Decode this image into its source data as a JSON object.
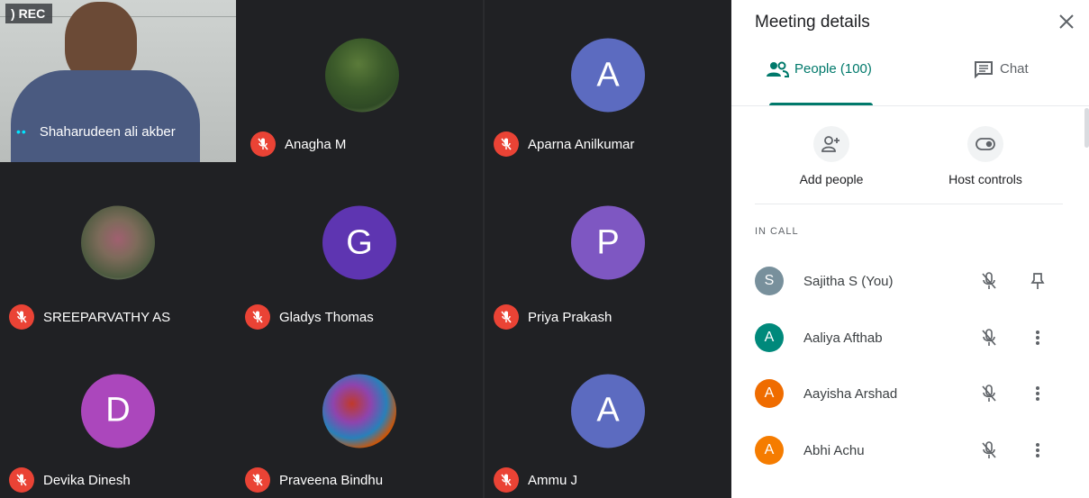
{
  "recording": {
    "label": "REC"
  },
  "tiles": [
    {
      "name": "Shaharudeen ali akber",
      "type": "video"
    },
    {
      "name": "Anagha M",
      "type": "photo",
      "photo": "photo-a",
      "muted": true
    },
    {
      "name": "Aparna Anilkumar",
      "type": "letter",
      "letter": "A",
      "color": "#5c6bc0",
      "muted": true
    },
    {
      "name": "SREEPARVATHY AS",
      "type": "photo",
      "photo": "photo-b",
      "muted": true
    },
    {
      "name": "Gladys Thomas",
      "type": "letter",
      "letter": "G",
      "color": "#5e35b1",
      "muted": true
    },
    {
      "name": "Priya Prakash",
      "type": "letter",
      "letter": "P",
      "color": "#7e57c2",
      "muted": true
    },
    {
      "name": "Devika Dinesh",
      "type": "letter",
      "letter": "D",
      "color": "#ab47bc",
      "muted": true
    },
    {
      "name": "Praveena Bindhu",
      "type": "photo",
      "photo": "photo-c",
      "muted": true
    },
    {
      "name": "Ammu J",
      "type": "letter",
      "letter": "A",
      "color": "#5c6bc0",
      "muted": true
    }
  ],
  "panel": {
    "title": "Meeting details",
    "tabs": {
      "people": "People (100)",
      "chat": "Chat"
    },
    "actions": {
      "add_people": "Add people",
      "host_controls": "Host controls"
    },
    "section_label": "IN CALL",
    "people": [
      {
        "name": "Sajitha S (You)",
        "initial": "S",
        "color": "#78909c",
        "trailing": "pin-icon"
      },
      {
        "name": "Aaliya Afthab",
        "initial": "A",
        "color": "#00897b",
        "trailing": "more-icon"
      },
      {
        "name": "Aayisha Arshad",
        "initial": "A",
        "color": "#ef6c00",
        "trailing": "more-icon"
      },
      {
        "name": "Abhi Achu",
        "initial": "A",
        "color": "#f57c00",
        "trailing": "more-icon"
      }
    ]
  },
  "colors": {
    "accent": "#00796b",
    "tile_bg": "#202124",
    "muted_red": "#ea4335"
  }
}
